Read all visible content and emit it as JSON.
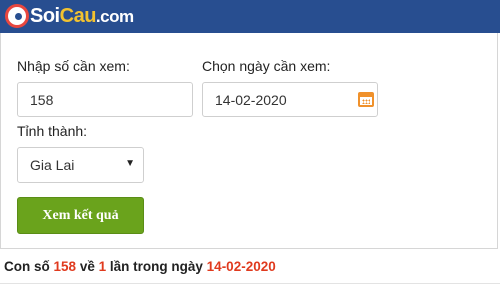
{
  "header": {
    "logo_part1": "Soi",
    "logo_part2": "Cau",
    "logo_part3": ".com",
    "background_color": "#284e90"
  },
  "form": {
    "number_label": "Nhập số cần xem:",
    "number_value": "158",
    "date_label": "Chọn ngày cần xem:",
    "date_value": "14-02-2020",
    "date_icon": "calendar-icon",
    "province_label": "Tỉnh thành:",
    "province_selected": "Gia Lai",
    "submit_label": "Xem kết quả",
    "submit_color": "#6aa31c"
  },
  "result": {
    "prefix": "Con số",
    "number": "158",
    "middle": "về",
    "count": "1",
    "suffix": "lần trong ngày",
    "date": "14-02-2020",
    "highlight_color": "#e03a1e"
  }
}
